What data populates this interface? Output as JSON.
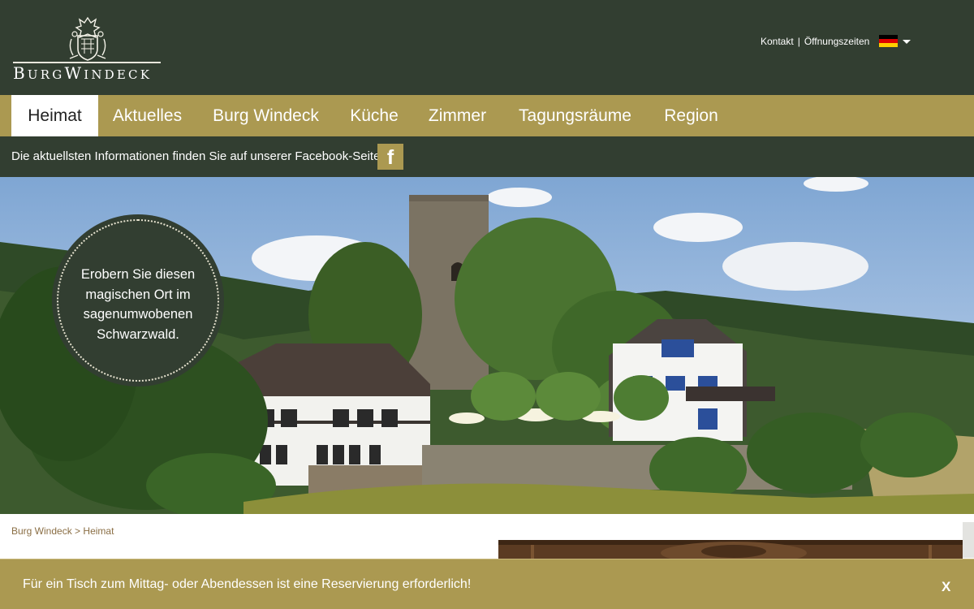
{
  "header": {
    "logo_text_first_cap": "B",
    "logo_text_first_rest": "URG",
    "logo_text_second_cap": "W",
    "logo_text_second_rest": "INDECK",
    "top_links": [
      {
        "label": "Kontakt"
      },
      {
        "label": "Öffnungszeiten"
      }
    ],
    "separator": "|",
    "language_flag_icon": "germany-flag-icon",
    "flag_colors": [
      "#000000",
      "#dd0000",
      "#ffce00"
    ]
  },
  "nav": {
    "items": [
      {
        "label": "Heimat",
        "active": true
      },
      {
        "label": "Aktuelles",
        "active": false
      },
      {
        "label": "Burg Windeck",
        "active": false
      },
      {
        "label": "Küche",
        "active": false
      },
      {
        "label": "Zimmer",
        "active": false
      },
      {
        "label": "Tagungsräume",
        "active": false
      },
      {
        "label": "Region",
        "active": false
      }
    ]
  },
  "infobar": {
    "text": "Die aktuellsten  Informationen finden Sie auf unserer  Facebook-Seite",
    "facebook_icon": "facebook-icon",
    "facebook_glyph": "f"
  },
  "hero": {
    "badge_line1": "Erobern Sie diesen",
    "badge_line2": "magischen Ort im",
    "badge_line3": "sagenumwobenen",
    "badge_line4": "Schwarzwald."
  },
  "breadcrumb": {
    "home": "Burg Windeck",
    "separator": ">",
    "current": "Heimat"
  },
  "notice": {
    "text": "Für ein Tisch zum  Mittag- oder Abendessen ist eine  Reservierung erforderlich!",
    "close_label": "X"
  },
  "colors": {
    "dark_green": "#323e31",
    "gold": "#ab9951",
    "breadcrumb": "#8a6e44"
  }
}
